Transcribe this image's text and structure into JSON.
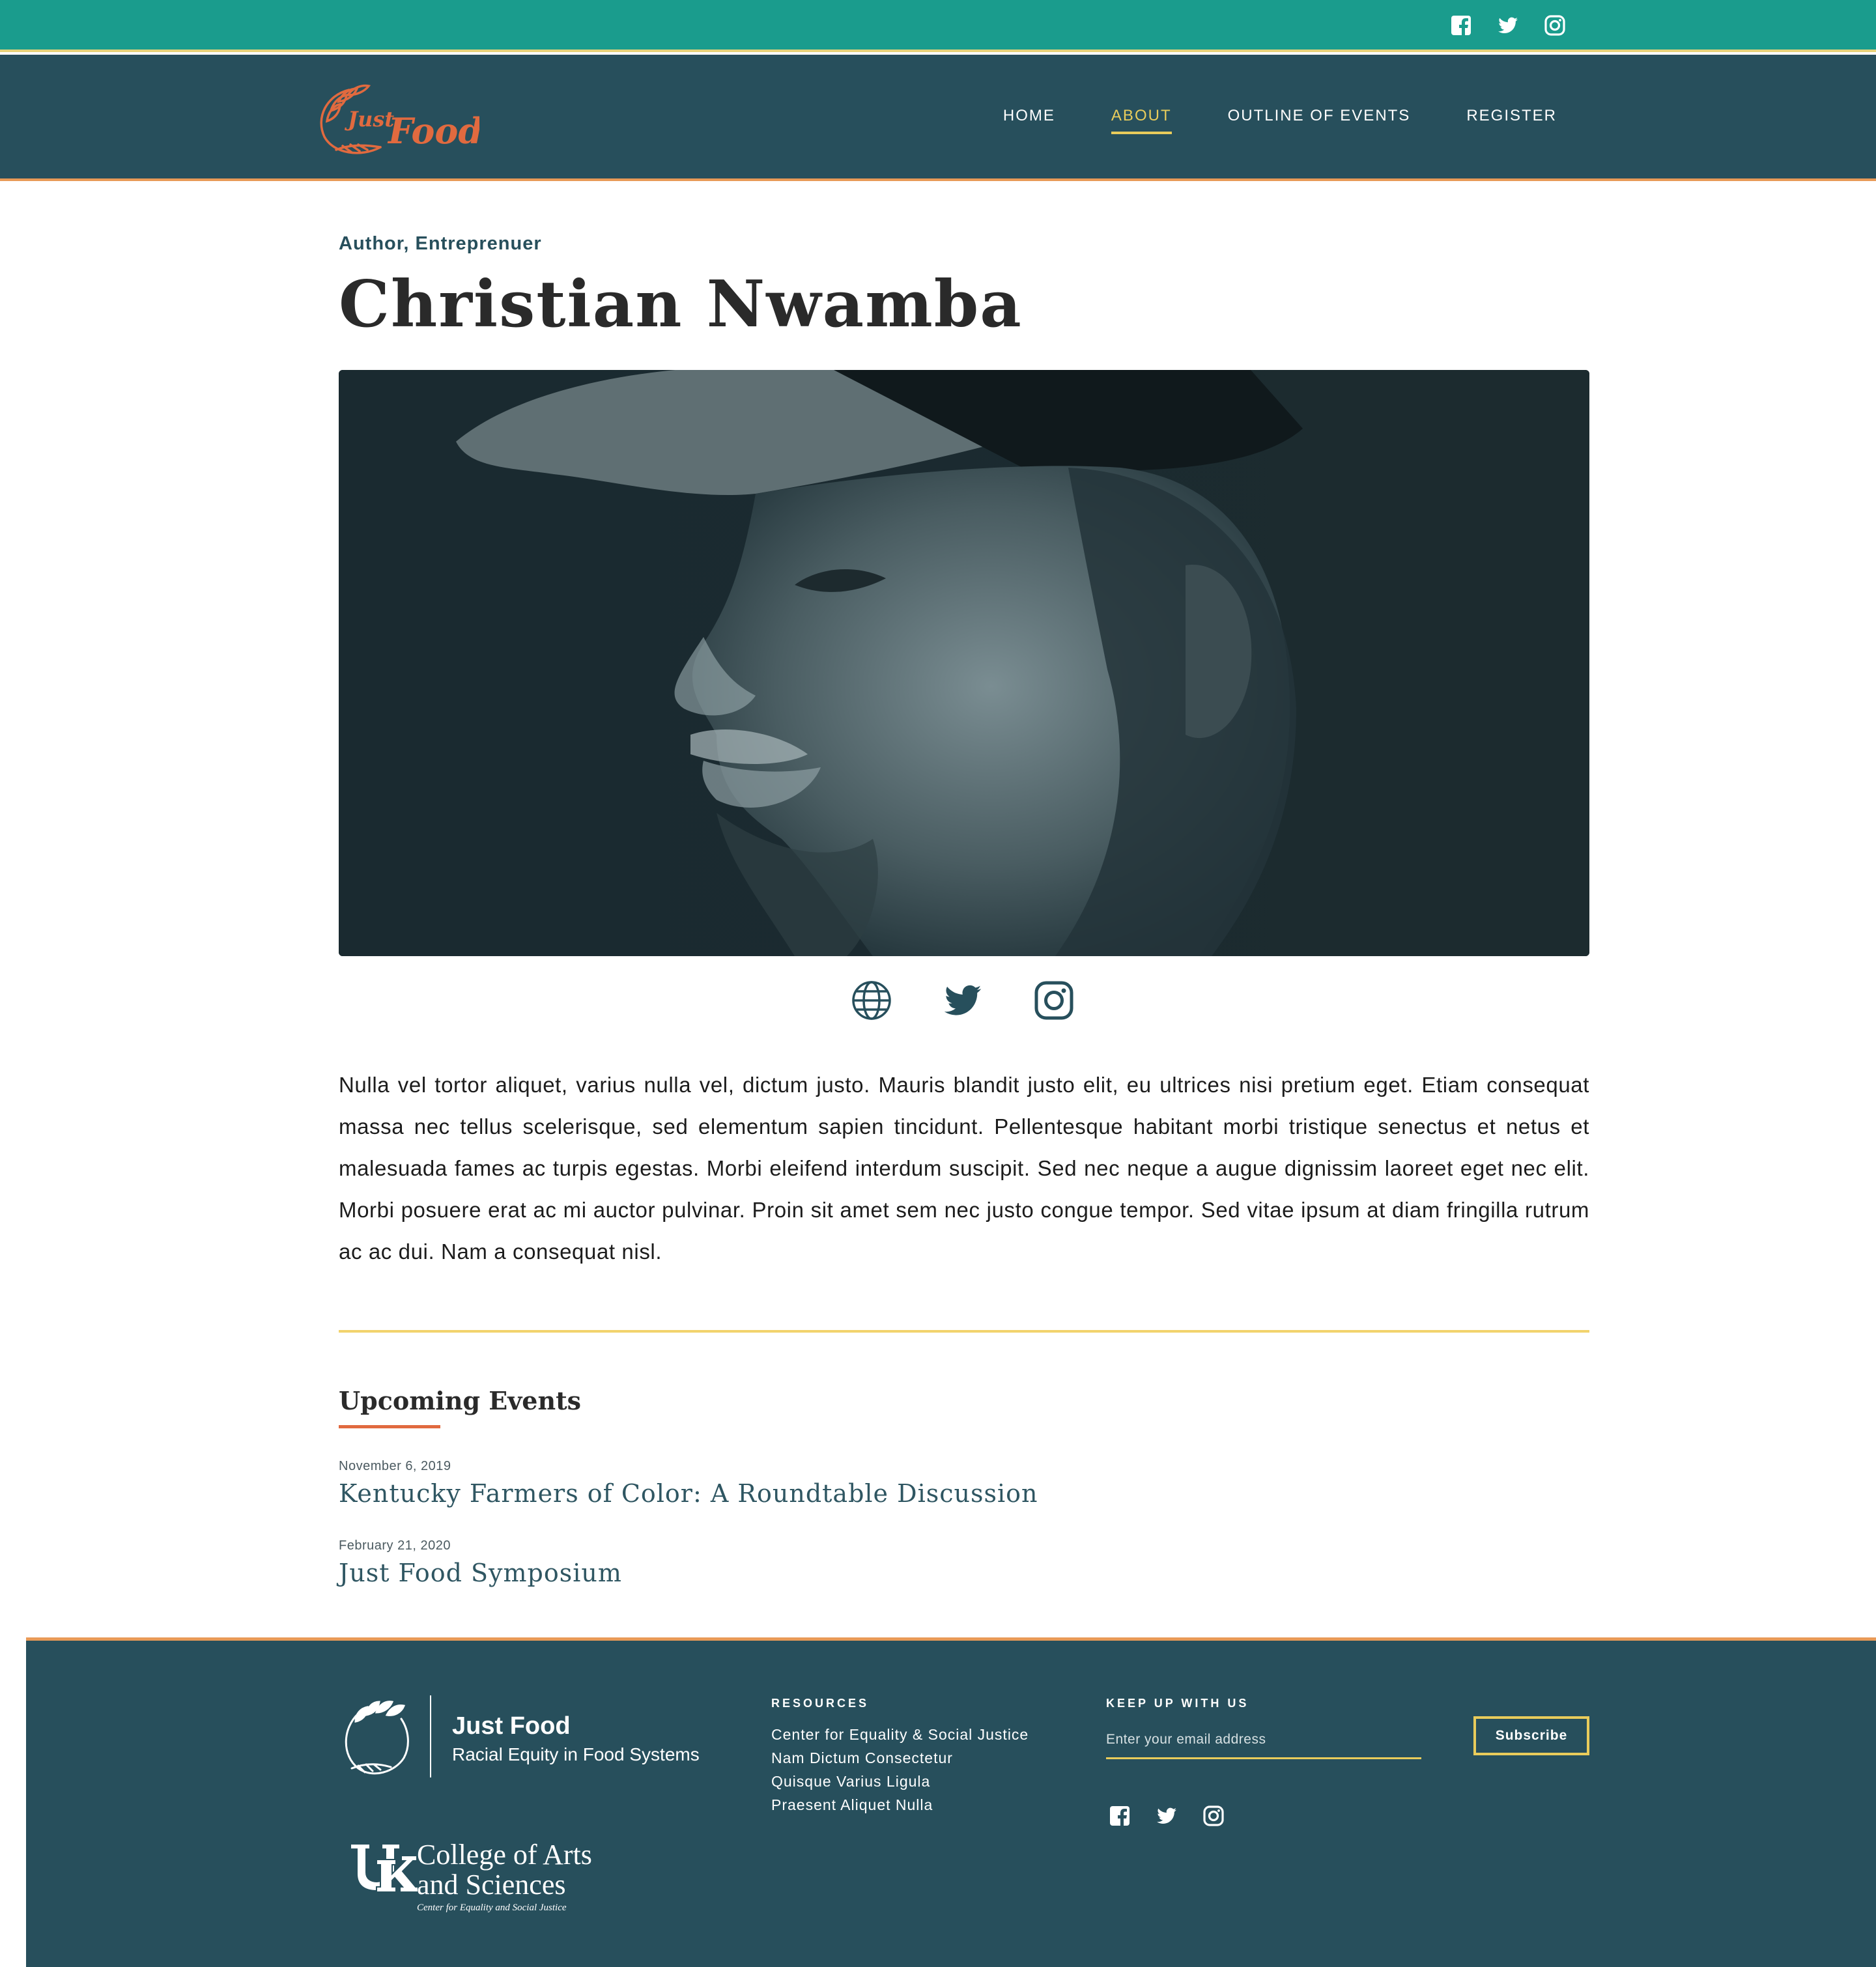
{
  "topbar": {
    "social": [
      "facebook-icon",
      "twitter-icon",
      "instagram-icon"
    ]
  },
  "brand": {
    "logo_text_1": "Just",
    "logo_text_2": "Food",
    "color_primary": "#274f5c",
    "color_teal": "#1a9c8d",
    "color_accent": "#e16a3f",
    "color_gold": "#e9cc5b"
  },
  "nav": {
    "items": [
      {
        "label": "HOME",
        "active": false
      },
      {
        "label": "ABOUT",
        "active": true
      },
      {
        "label": "OUTLINE OF EVENTS",
        "active": false
      },
      {
        "label": "REGISTER",
        "active": false
      }
    ]
  },
  "profile": {
    "role": "Author, Entreprenuer",
    "name": "Christian Nwamba",
    "links": [
      "globe-icon",
      "twitter-icon",
      "instagram-icon"
    ],
    "bio": "Nulla vel tortor aliquet, varius nulla vel, dictum justo. Mauris blandit justo elit, eu ultrices nisi pretium eget. Etiam consequat massa nec tellus scelerisque, sed elementum sapien tincidunt. Pellentesque habitant morbi tristique senectus et netus et malesuada fames ac turpis egestas. Morbi eleifend interdum suscipit. Sed nec neque a augue dignissim laoreet eget nec elit. Morbi posuere erat ac mi auctor pulvinar. Proin sit amet sem nec justo congue tempor. Sed vitae ipsum at diam fringilla rutrum ac ac dui. Nam a consequat nisl."
  },
  "events": {
    "title": "Upcoming Events",
    "items": [
      {
        "date": "November 6, 2019",
        "title": "Kentucky Farmers of Color: A Roundtable Discussion"
      },
      {
        "date": "February 21, 2020",
        "title": "Just Food Symposium"
      }
    ]
  },
  "footer": {
    "brand_title": "Just Food",
    "brand_subtitle": "Racial Equity in Food Systems",
    "college_line1": "College of Arts",
    "college_line2": "and Sciences",
    "college_line3": "Center for Equality and Social Justice",
    "resources_heading": "RESOURCES",
    "resources": [
      "Center for Equality & Social Justice",
      "Nam Dictum Consectetur",
      "Quisque Varius Ligula",
      "Praesent Aliquet Nulla"
    ],
    "keep_heading": "KEEP UP WITH US",
    "email_placeholder": "Enter your email address",
    "subscribe_label": "Subscribe",
    "social": [
      "facebook-icon",
      "twitter-icon",
      "instagram-icon"
    ]
  }
}
